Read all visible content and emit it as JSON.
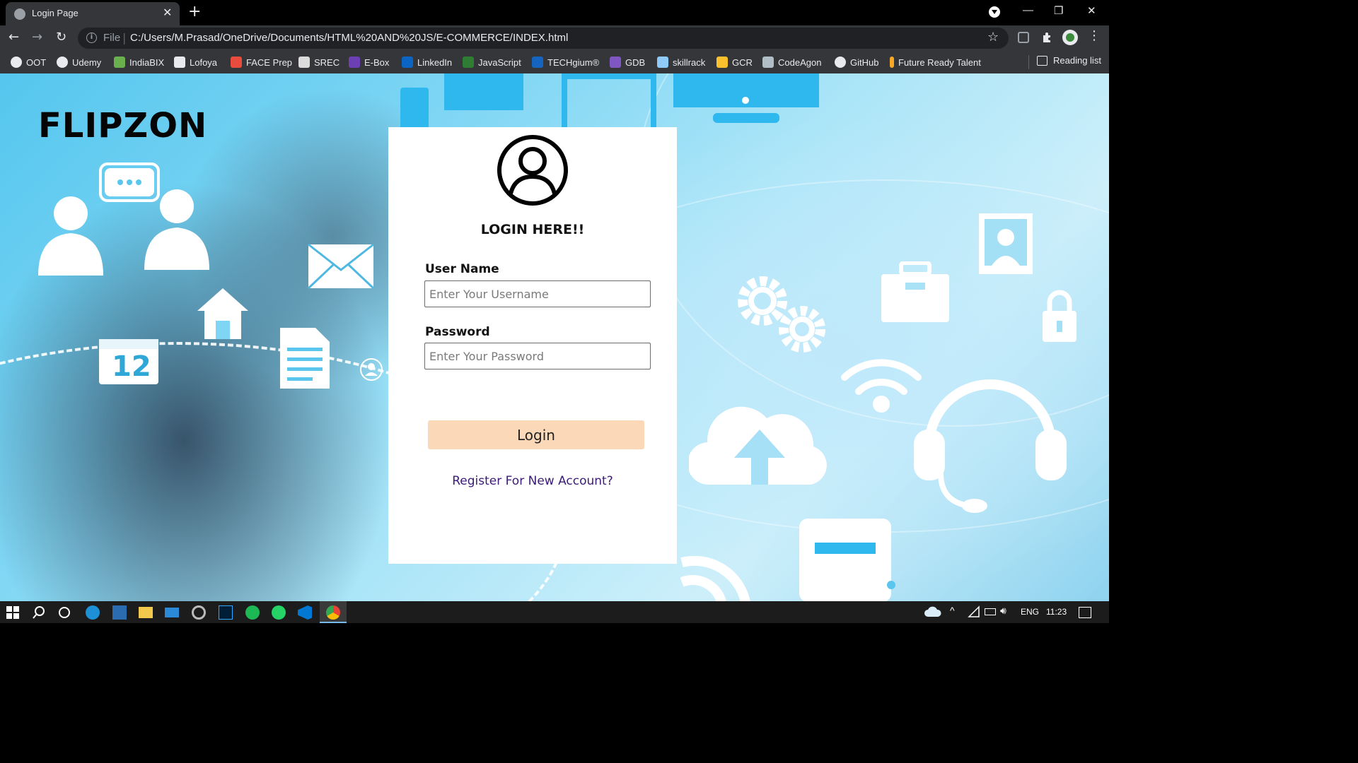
{
  "browser": {
    "tab_title": "Login Page",
    "url_scheme_label": "File",
    "url": "C:/Users/M.Prasad/OneDrive/Documents/HTML%20AND%20JS/E-COMMERCE/INDEX.html",
    "reading_list_label": "Reading list"
  },
  "bookmarks": [
    {
      "label": "OOT",
      "icon": "globe-icon",
      "color": "#e8eaed"
    },
    {
      "label": "Udemy",
      "icon": "udemy-icon",
      "color": "#e8eaed"
    },
    {
      "label": "IndiaBIX",
      "icon": "indiabix-icon",
      "color": "#6ab04c"
    },
    {
      "label": "Lofoya",
      "icon": "lofoya-icon",
      "color": "#e8eaed"
    },
    {
      "label": "FACE Prep",
      "icon": "faceprep-icon",
      "color": "#e74c3c"
    },
    {
      "label": "SREC",
      "icon": "srec-icon",
      "color": "#dcdcdc"
    },
    {
      "label": "E-Box",
      "icon": "ebox-icon",
      "color": "#6c3fb5"
    },
    {
      "label": "LinkedIn",
      "icon": "linkedin-icon",
      "color": "#0a66c2"
    },
    {
      "label": "JavaScript",
      "icon": "javascript-icon",
      "color": "#2e7d32"
    },
    {
      "label": "TECHgium®",
      "icon": "techgium-icon",
      "color": "#1565c0"
    },
    {
      "label": "GDB",
      "icon": "gdb-icon",
      "color": "#7e57c2"
    },
    {
      "label": "skillrack",
      "icon": "skillrack-icon",
      "color": "#90caf9"
    },
    {
      "label": "GCR",
      "icon": "gcr-icon",
      "color": "#fbc02d"
    },
    {
      "label": "CodeAgon",
      "icon": "codeagon-icon",
      "color": "#b0bec5"
    },
    {
      "label": "GitHub",
      "icon": "github-icon",
      "color": "#e8eaed"
    },
    {
      "label": "Future Ready Talent",
      "icon": "future-ready-icon",
      "color": "#f9a825"
    }
  ],
  "page": {
    "logo": "FLIPZON",
    "login_heading": "LOGIN HERE!!",
    "username_label": "User Name",
    "username_placeholder": "Enter Your Username",
    "password_label": "Password",
    "password_placeholder": "Enter Your Password",
    "login_button": "Login",
    "register_link": "Register For New Account?",
    "calendar_day": "12"
  },
  "taskbar": {
    "language": "ENG",
    "time": "11:23"
  },
  "colors": {
    "login_button_bg": "#fbd8b7",
    "register_link": "#3c1a78",
    "background_accent": "#55c6ee"
  }
}
